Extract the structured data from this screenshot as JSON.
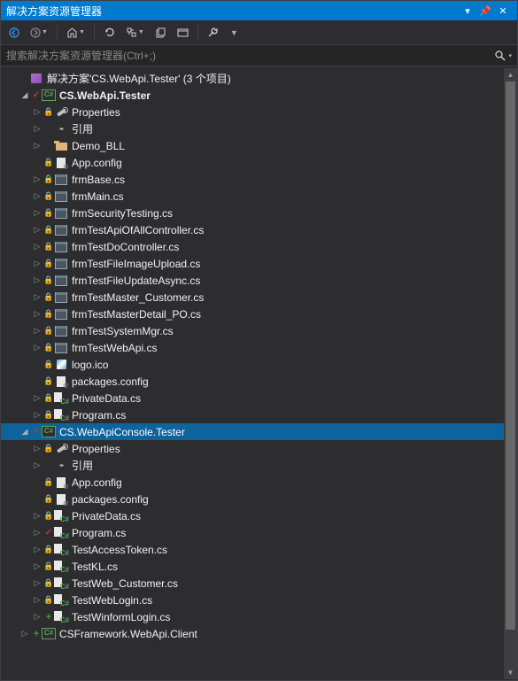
{
  "title": "解决方案资源管理器",
  "search_placeholder": "搜索解决方案资源管理器(Ctrl+;)",
  "solution_label": "解决方案'CS.WebApi.Tester' (3 个项目)",
  "toolbar": {
    "back": "◀",
    "forward": "▶",
    "home": "⌂",
    "sync": "⟳",
    "collapse": "⇈",
    "showall": "⊞",
    "properties": "🔧",
    "preview": "👁"
  },
  "tree": [
    {
      "indent": 0,
      "arrow": "none",
      "vcs": "blank",
      "icon": "sln",
      "label_key": "solution_label",
      "bold": false
    },
    {
      "indent": 1,
      "arrow": "open",
      "vcs": "check",
      "icon": "csproj",
      "label": "CS.WebApi.Tester",
      "bold": true
    },
    {
      "indent": 2,
      "arrow": "closed",
      "vcs": "lock",
      "icon": "wrench",
      "label": "Properties"
    },
    {
      "indent": 2,
      "arrow": "closed",
      "vcs": "blank",
      "icon": "ref",
      "label": "引用"
    },
    {
      "indent": 2,
      "arrow": "closed",
      "vcs": "blank",
      "icon": "folder",
      "label": "Demo_BLL"
    },
    {
      "indent": 2,
      "arrow": "none",
      "vcs": "lock",
      "icon": "config",
      "label": "App.config"
    },
    {
      "indent": 2,
      "arrow": "closed",
      "vcs": "lock",
      "icon": "form",
      "label": "frmBase.cs"
    },
    {
      "indent": 2,
      "arrow": "closed",
      "vcs": "lock",
      "icon": "form",
      "label": "frmMain.cs"
    },
    {
      "indent": 2,
      "arrow": "closed",
      "vcs": "lock",
      "icon": "form",
      "label": "frmSecurityTesting.cs"
    },
    {
      "indent": 2,
      "arrow": "closed",
      "vcs": "lock",
      "icon": "form",
      "label": "frmTestApiOfAllController.cs"
    },
    {
      "indent": 2,
      "arrow": "closed",
      "vcs": "lock",
      "icon": "form",
      "label": "frmTestDoController.cs"
    },
    {
      "indent": 2,
      "arrow": "closed",
      "vcs": "lock",
      "icon": "form",
      "label": "frmTestFileImageUpload.cs"
    },
    {
      "indent": 2,
      "arrow": "closed",
      "vcs": "lock",
      "icon": "form",
      "label": "frmTestFileUpdateAsync.cs"
    },
    {
      "indent": 2,
      "arrow": "closed",
      "vcs": "lock",
      "icon": "form",
      "label": "frmTestMaster_Customer.cs"
    },
    {
      "indent": 2,
      "arrow": "closed",
      "vcs": "lock",
      "icon": "form",
      "label": "frmTestMasterDetail_PO.cs"
    },
    {
      "indent": 2,
      "arrow": "closed",
      "vcs": "lock",
      "icon": "form",
      "label": "frmTestSystemMgr.cs"
    },
    {
      "indent": 2,
      "arrow": "closed",
      "vcs": "lock",
      "icon": "form",
      "label": "frmTestWebApi.cs"
    },
    {
      "indent": 2,
      "arrow": "none",
      "vcs": "lock",
      "icon": "ico",
      "label": "logo.ico"
    },
    {
      "indent": 2,
      "arrow": "none",
      "vcs": "lock",
      "icon": "config",
      "label": "packages.config"
    },
    {
      "indent": 2,
      "arrow": "closed",
      "vcs": "lock",
      "icon": "cs",
      "label": "PrivateData.cs"
    },
    {
      "indent": 2,
      "arrow": "closed",
      "vcs": "lock",
      "icon": "cs",
      "label": "Program.cs"
    },
    {
      "indent": 1,
      "arrow": "open",
      "vcs": "check",
      "icon": "csproj",
      "label": "CS.WebApiConsole.Tester",
      "selected": true
    },
    {
      "indent": 2,
      "arrow": "closed",
      "vcs": "lock",
      "icon": "wrench",
      "label": "Properties"
    },
    {
      "indent": 2,
      "arrow": "closed",
      "vcs": "blank",
      "icon": "ref",
      "label": "引用"
    },
    {
      "indent": 2,
      "arrow": "none",
      "vcs": "lock",
      "icon": "config",
      "label": "App.config"
    },
    {
      "indent": 2,
      "arrow": "none",
      "vcs": "lock",
      "icon": "config",
      "label": "packages.config"
    },
    {
      "indent": 2,
      "arrow": "closed",
      "vcs": "lock",
      "icon": "cs",
      "label": "PrivateData.cs"
    },
    {
      "indent": 2,
      "arrow": "closed",
      "vcs": "check",
      "icon": "cs",
      "label": "Program.cs"
    },
    {
      "indent": 2,
      "arrow": "closed",
      "vcs": "lock",
      "icon": "cs",
      "label": "TestAccessToken.cs"
    },
    {
      "indent": 2,
      "arrow": "closed",
      "vcs": "lock",
      "icon": "cs",
      "label": "TestKL.cs"
    },
    {
      "indent": 2,
      "arrow": "closed",
      "vcs": "lock",
      "icon": "cs",
      "label": "TestWeb_Customer.cs"
    },
    {
      "indent": 2,
      "arrow": "closed",
      "vcs": "lock",
      "icon": "cs",
      "label": "TestWebLogin.cs"
    },
    {
      "indent": 2,
      "arrow": "closed",
      "vcs": "plus",
      "icon": "cs",
      "label": "TestWinformLogin.cs"
    },
    {
      "indent": 1,
      "arrow": "closed",
      "vcs": "plus",
      "icon": "csproj",
      "label": "CSFramework.WebApi.Client"
    }
  ]
}
